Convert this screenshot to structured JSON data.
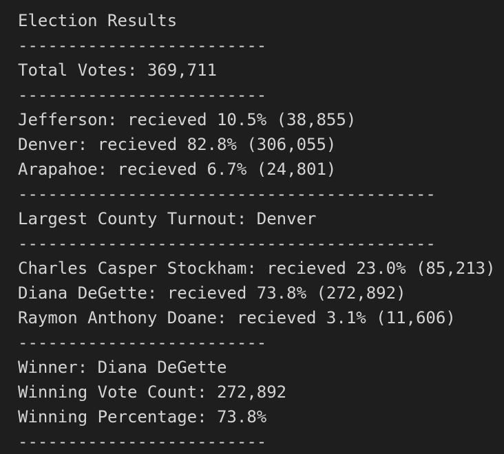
{
  "output": {
    "lines": [
      "Election Results",
      "-------------------------",
      "Total Votes: 369,711",
      "-------------------------",
      "Jefferson: recieved 10.5% (38,855)",
      "Denver: recieved 82.8% (306,055)",
      "Arapahoe: recieved 6.7% (24,801)",
      "------------------------------------------",
      "Largest County Turnout: Denver",
      "------------------------------------------",
      "Charles Casper Stockham: recieved 23.0% (85,213)",
      "Diana DeGette: recieved 73.8% (272,892)",
      "Raymon Anthony Doane: recieved 3.1% (11,606)",
      "-------------------------",
      "Winner: Diana DeGette",
      "Winning Vote Count: 272,892",
      "Winning Percentage: 73.8%",
      "-------------------------"
    ]
  }
}
